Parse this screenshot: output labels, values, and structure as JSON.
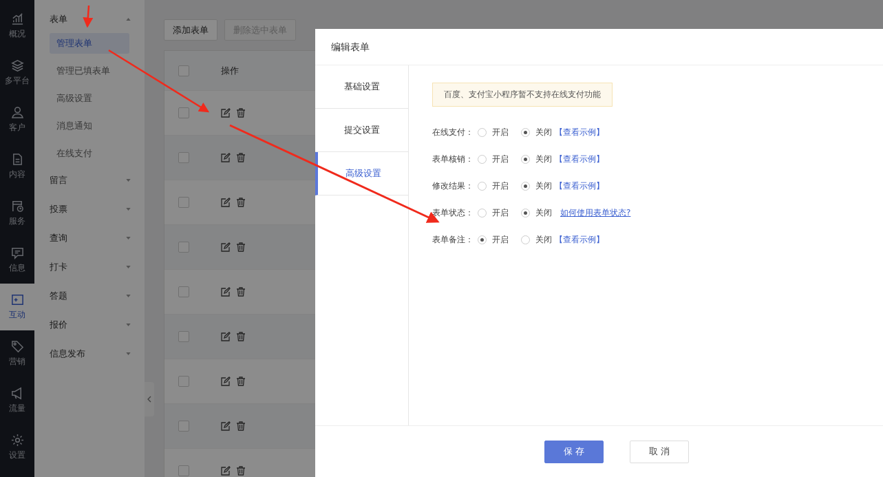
{
  "nav": [
    {
      "label": "概况",
      "selected": false
    },
    {
      "label": "多平台",
      "selected": false
    },
    {
      "label": "客户",
      "selected": false
    },
    {
      "label": "内容",
      "selected": false
    },
    {
      "label": "服务",
      "selected": false
    },
    {
      "label": "信息",
      "selected": false
    },
    {
      "label": "互动",
      "selected": true
    },
    {
      "label": "营销",
      "selected": false
    },
    {
      "label": "流量",
      "selected": false
    },
    {
      "label": "设置",
      "selected": false
    }
  ],
  "submenu": [
    {
      "label": "表单",
      "expanded": true,
      "children": [
        {
          "label": "管理表单",
          "selected": true
        },
        {
          "label": "管理已填表单",
          "selected": false
        },
        {
          "label": "高级设置",
          "selected": false
        },
        {
          "label": "消息通知",
          "selected": false
        },
        {
          "label": "在线支付",
          "selected": false
        }
      ]
    },
    {
      "label": "留言",
      "expanded": false
    },
    {
      "label": "投票",
      "expanded": false
    },
    {
      "label": "查询",
      "expanded": false
    },
    {
      "label": "打卡",
      "expanded": false
    },
    {
      "label": "答题",
      "expanded": false
    },
    {
      "label": "报价",
      "expanded": false
    },
    {
      "label": "信息发布",
      "expanded": false
    }
  ],
  "toolbar": [
    {
      "label": "添加表单",
      "disabled": false
    },
    {
      "label": "删除选中表单",
      "disabled": true
    }
  ],
  "table": {
    "header_checked": false,
    "columns": [
      "操作"
    ],
    "rows": [
      {
        "checked": false
      },
      {
        "checked": false
      },
      {
        "checked": false
      },
      {
        "checked": false
      },
      {
        "checked": false
      },
      {
        "checked": false
      },
      {
        "checked": false
      },
      {
        "checked": false
      },
      {
        "checked": false
      }
    ]
  },
  "dialog": {
    "title": "编辑表单",
    "tabs": [
      {
        "label": "基础设置",
        "selected": false
      },
      {
        "label": "提交设置",
        "selected": false
      },
      {
        "label": "高级设置",
        "selected": true
      }
    ],
    "notice": "百度、支付宝小程序暂不支持在线支付功能",
    "settings": [
      {
        "label": "在线支付：",
        "options": [
          {
            "label": "开启",
            "selected": false
          },
          {
            "label": "关闭",
            "selected": true
          }
        ],
        "link": {
          "kind": "bracket",
          "text": "【查看示例】"
        }
      },
      {
        "label": "表单核销：",
        "options": [
          {
            "label": "开启",
            "selected": false
          },
          {
            "label": "关闭",
            "selected": true
          }
        ],
        "link": {
          "kind": "bracket",
          "text": "【查看示例】"
        }
      },
      {
        "label": "修改结果：",
        "options": [
          {
            "label": "开启",
            "selected": false
          },
          {
            "label": "关闭",
            "selected": true
          }
        ],
        "link": {
          "kind": "bracket",
          "text": "【查看示例】"
        }
      },
      {
        "label": "表单状态：",
        "options": [
          {
            "label": "开启",
            "selected": false
          },
          {
            "label": "关闭",
            "selected": true
          }
        ],
        "link": {
          "kind": "underline",
          "text": "如何使用表单状态?"
        }
      },
      {
        "label": "表单备注：",
        "options": [
          {
            "label": "开启",
            "selected": true
          },
          {
            "label": "关闭",
            "selected": false
          }
        ],
        "link": {
          "kind": "bracket",
          "text": "【查看示例】"
        }
      }
    ],
    "buttons": [
      {
        "label": "保 存",
        "kind": "primary"
      },
      {
        "label": "取 消",
        "kind": "default"
      }
    ]
  }
}
